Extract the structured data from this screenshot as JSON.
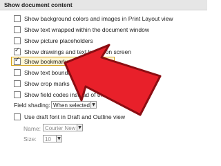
{
  "section": {
    "title": "Show document content"
  },
  "options": [
    {
      "label": "Show background colors and images in Print Layout view",
      "checked": false
    },
    {
      "label": "Show text wrapped within the document window",
      "checked": false
    },
    {
      "label": "Show picture placeholders",
      "checked": false
    },
    {
      "label": "Show drawings and text boxes on screen",
      "checked": true
    },
    {
      "label": "Show bookmarks",
      "checked": true
    },
    {
      "label": "Show text boundaries",
      "checked": false
    },
    {
      "label": "Show crop marks",
      "checked": false
    },
    {
      "label": "Show field codes instead of th",
      "checked": false
    }
  ],
  "field_shading": {
    "label": "Field shading:",
    "value": "When selected"
  },
  "draft_font": {
    "label": "Use draft font in Draft and Outline view",
    "checked": false
  },
  "name_field": {
    "label": "Name:",
    "value": "Courier New"
  },
  "size_field": {
    "label": "Size:",
    "value": "10"
  },
  "colors": {
    "arrow": "#e8202a",
    "arrow_outline": "#8b0d12",
    "highlight": "#d4a017"
  }
}
